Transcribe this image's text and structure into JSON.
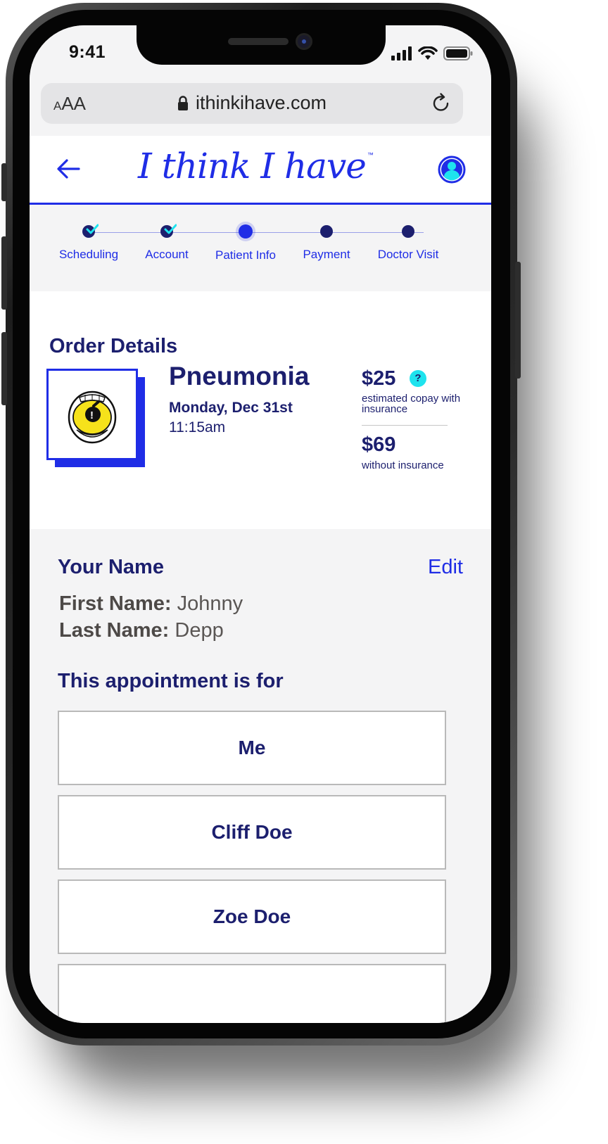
{
  "status_bar": {
    "time": "9:41"
  },
  "browser": {
    "text_size_label": "AA",
    "url": "ithinkihave.com"
  },
  "header": {
    "logo_text": "I think I have",
    "logo_tm": "™"
  },
  "stepper": {
    "steps": [
      {
        "label": "Scheduling",
        "state": "done"
      },
      {
        "label": "Account",
        "state": "done"
      },
      {
        "label": "Patient Info",
        "state": "current"
      },
      {
        "label": "Payment",
        "state": "upcoming"
      },
      {
        "label": "Doctor Visit",
        "state": "upcoming"
      }
    ]
  },
  "order": {
    "title": "Order Details",
    "illness": "Pneumonia",
    "date": "Monday, Dec 31st",
    "time": "11:15am",
    "price_with_insurance": "$25",
    "price_with_insurance_note": "estimated copay with insurance",
    "help_label": "?",
    "price_without_insurance": "$69",
    "price_without_insurance_note": "without insurance"
  },
  "your_name": {
    "title": "Your Name",
    "edit_label": "Edit",
    "first_name_label": "First Name:",
    "first_name": "Johnny",
    "last_name_label": "Last Name:",
    "last_name": "Depp"
  },
  "appointment_for": {
    "title": "This appointment is for",
    "options": [
      "Me",
      "Cliff Doe",
      "Zoe Doe"
    ]
  },
  "colors": {
    "brand_blue": "#1f2de6",
    "navy": "#1c1f6e",
    "help_cyan": "#1ee3ee",
    "background": "#f4f4f5"
  }
}
